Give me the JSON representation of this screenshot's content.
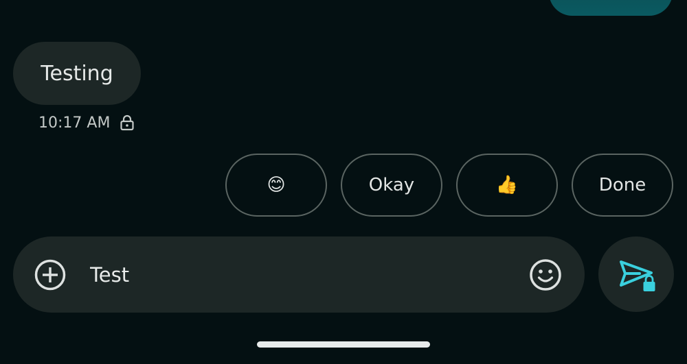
{
  "colors": {
    "background": "#041012",
    "bubble": "#1d2726",
    "sent_bubble": "#0a5a61",
    "accent": "#3ad0de",
    "chip_border": "#5b6562"
  },
  "incoming_message": {
    "text": "Testing",
    "time": "10:17 AM",
    "status_icon": "lock-icon"
  },
  "smart_replies": [
    {
      "label": "😊",
      "kind": "emoji"
    },
    {
      "label": "Okay",
      "kind": "text"
    },
    {
      "label": "👍",
      "kind": "emoji"
    },
    {
      "label": "Done",
      "kind": "text"
    }
  ],
  "composer": {
    "value": "Test",
    "add_icon": "add-circle-icon",
    "emoji_icon": "emoji-icon",
    "send_icon": "send-encrypted-icon"
  }
}
